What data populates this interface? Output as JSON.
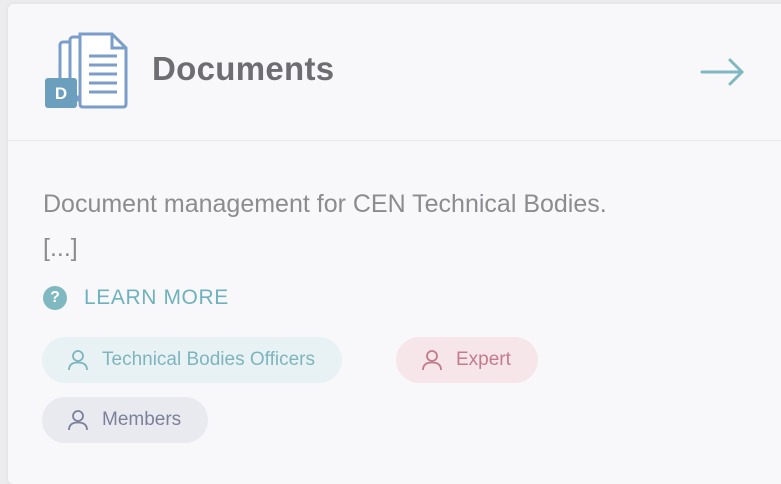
{
  "card": {
    "title": "Documents",
    "icon_badge": "D",
    "description_line1": "Document management for CEN Technical Bodies.",
    "description_line2": "[...]",
    "learn_more_label": "LEARN MORE",
    "help_icon_glyph": "?"
  },
  "tags": [
    {
      "label": "Technical Bodies Officers",
      "icon": "user-icon"
    },
    {
      "label": "Expert",
      "icon": "user-icon"
    },
    {
      "label": "Members",
      "icon": "user-icon"
    }
  ],
  "colors": {
    "accent_teal": "#7fb8c1",
    "expert_pink": "#c37b8d",
    "members_slate": "#7b819a",
    "title_gray": "#6e6e72",
    "text_gray": "#8c8c90"
  }
}
